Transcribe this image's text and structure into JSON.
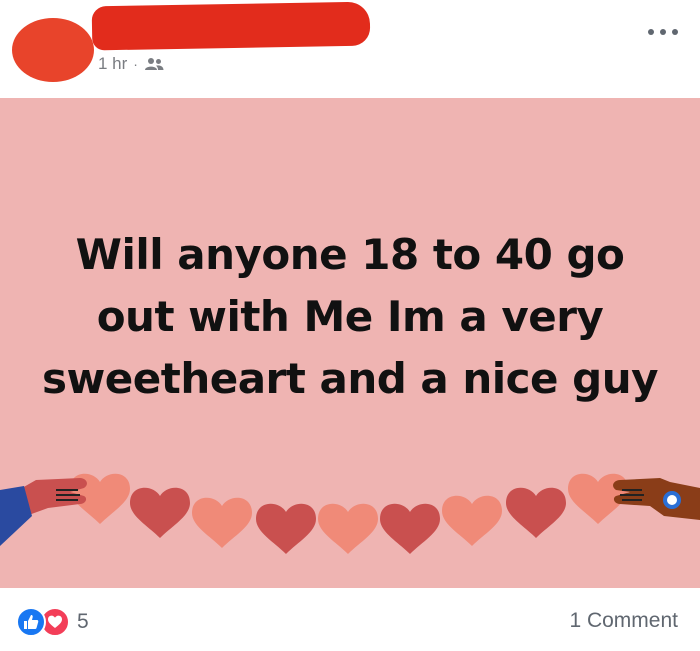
{
  "post": {
    "timestamp": "1 hr",
    "separator": "·",
    "audience_icon": "friends-icon",
    "more_icon": "more-options-icon",
    "text": "Will anyone 18 to 40 go out with Me Im a very sweetheart and a nice guy",
    "background_color": "#efb4b2"
  },
  "footer": {
    "reactions": [
      "like-icon",
      "love-icon"
    ],
    "reaction_count": "5",
    "comments_label": "1 Comment"
  }
}
